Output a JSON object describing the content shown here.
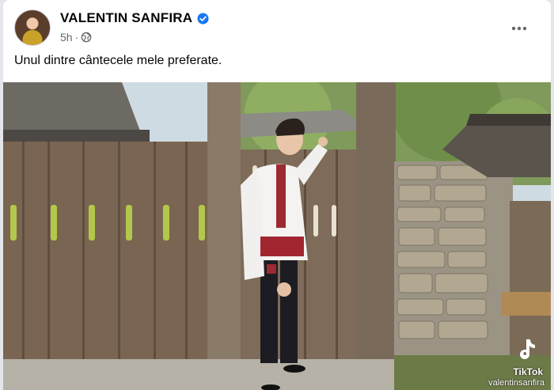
{
  "post": {
    "author": "VALENTIN SANFIRA",
    "time": "5h",
    "separator": "·",
    "caption": "Unul dintre cântecele mele preferate.",
    "audience_icon": "globe-icon",
    "verified_icon": "verified-badge-icon",
    "more_icon": "more-options-icon"
  },
  "media": {
    "watermark_logo": "TikTok",
    "watermark_handle": "valentinsanfira"
  },
  "colors": {
    "verified_blue": "#1877f2",
    "meta_gray": "#65676b"
  }
}
